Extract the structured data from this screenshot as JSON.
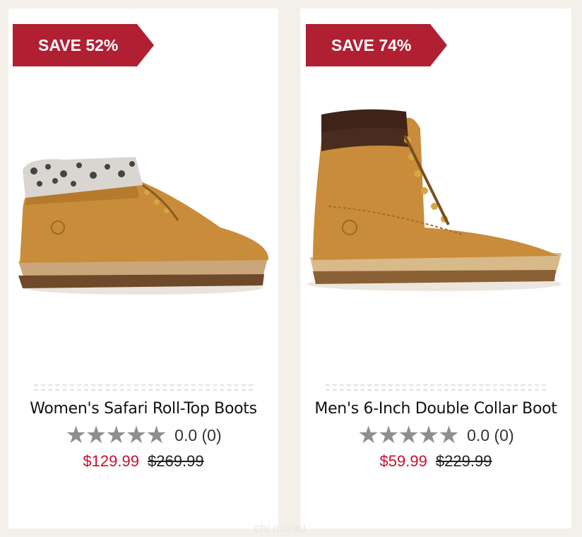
{
  "products": [
    {
      "badge": "SAVE 52%",
      "name": "Women's Safari Roll-Top Boots",
      "stars": "★★★★★",
      "rating": "0.0 (0)",
      "sale_price": "$129.99",
      "original_price": "$269.99"
    },
    {
      "badge": "SAVE 74%",
      "name": "Men's 6-Inch Double Collar Boot",
      "stars": "★★★★★",
      "rating": "0.0 (0)",
      "sale_price": "$59.99",
      "original_price": "$229.99"
    }
  ],
  "watermark": "chi nazau",
  "colors": {
    "badge": "#b01f32",
    "sale_price": "#c8102e",
    "background": "#f3f0ea",
    "boot_leather": "#c98c3a"
  }
}
